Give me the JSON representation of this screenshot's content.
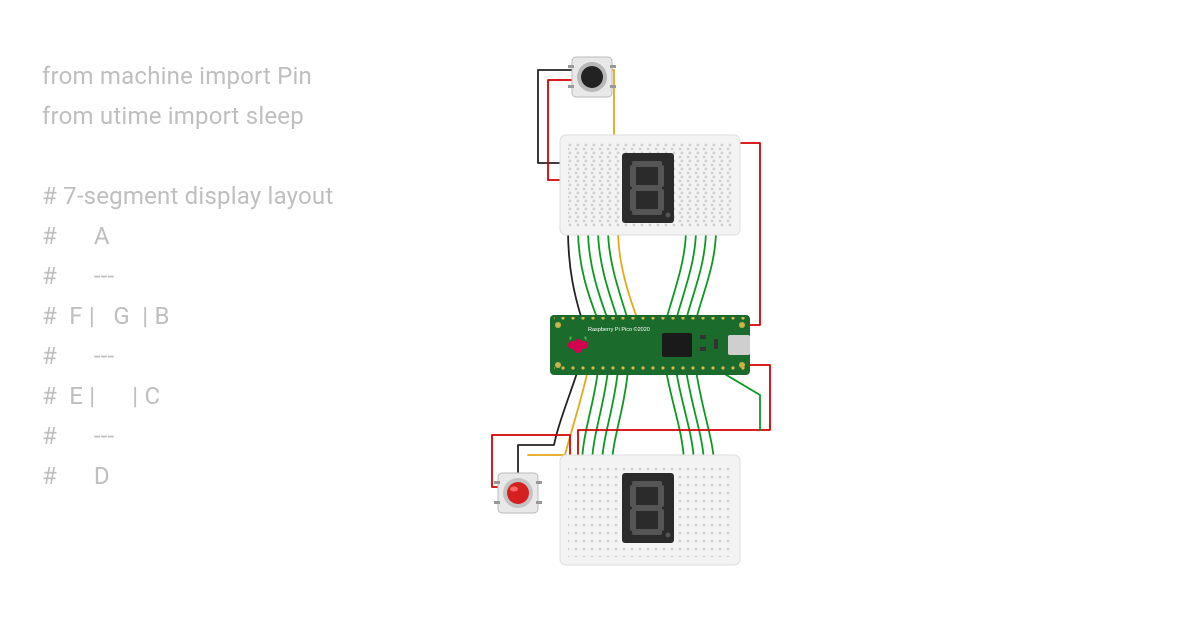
{
  "code": {
    "lines": [
      "from machine import Pin",
      "from utime import sleep",
      "",
      "# 7-segment display layout",
      "#      A",
      "#      ---",
      "#  F |   G  | B",
      "#      ---",
      "#  E |      | C",
      "#      ---",
      "#      D"
    ]
  },
  "board": {
    "label": "Raspberry Pi Pico ©2020"
  },
  "components": {
    "button_top": {
      "color": "#222",
      "ring": "#bbb"
    },
    "button_bottom": {
      "color": "#d62020",
      "ring": "#ccc"
    },
    "breadboard_top": true,
    "breadboard_bottom": true,
    "seven_seg_top": true,
    "seven_seg_bottom": true
  },
  "wire_colors": {
    "power": "#d40000",
    "ground": "#222",
    "signal": "#0a9a22",
    "aux": "#e6a817"
  }
}
